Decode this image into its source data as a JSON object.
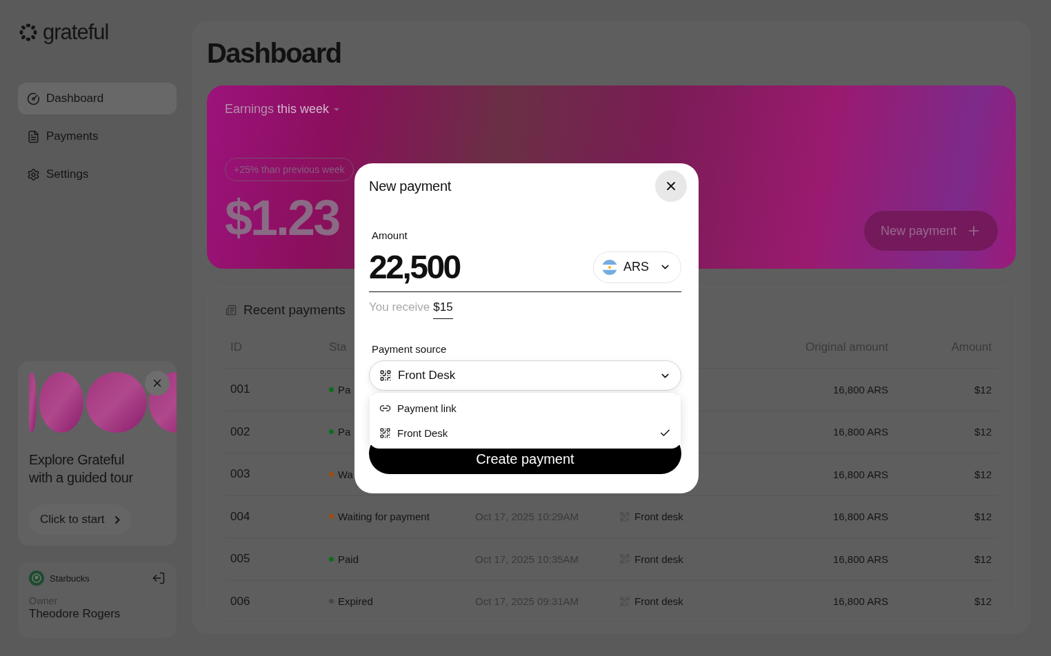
{
  "sidebar": {
    "logo": "grateful",
    "nav": [
      {
        "label": "Dashboard",
        "selected": true
      },
      {
        "label": "Payments",
        "selected": false
      },
      {
        "label": "Settings",
        "selected": false
      }
    ],
    "tour": {
      "title": "Explore Grateful with a guided tour",
      "button": "Click to start"
    },
    "account": {
      "business": "Starbucks",
      "role": "Owner",
      "name": "Theodore Rogers"
    }
  },
  "page": {
    "title": "Dashboard"
  },
  "earnings": {
    "period": "Earnings **this week**",
    "change": "+25% than previous week",
    "total": "$1.23",
    "button": "New payment"
  },
  "recent": {
    "title": "Recent payments",
    "columns": [
      "ID",
      "Sta",
      "Original amount",
      "Amount"
    ],
    "rows": [
      {
        "id": "001",
        "status": "Pa",
        "color": "#0e6e1f",
        "original": "16,800 ARS",
        "amount": "$12"
      },
      {
        "id": "002",
        "status": "Pa",
        "color": "#0e6e1f",
        "original": "16,800 ARS",
        "amount": "$12"
      },
      {
        "id": "003",
        "status": "Wa",
        "color": "#a04a12",
        "original": "16,800 ARS",
        "amount": "$12"
      },
      {
        "id": "004",
        "status": "Waiting for payment",
        "color": "#a04a12",
        "date": "Oct 17, 2025 10:29AM",
        "source": "Front desk",
        "original": "16,800 ARS",
        "amount": "$12"
      },
      {
        "id": "005",
        "status": "Paid",
        "color": "#0e6e1f",
        "date": "Oct 17, 2025 10:35AM",
        "source": "Front desk",
        "original": "16,800 ARS",
        "amount": "$12"
      },
      {
        "id": "006",
        "status": "Expired",
        "color": "#474747",
        "date": "Oct 17, 2025 09:31AM",
        "source": "Front desk",
        "original": "16,800 ARS",
        "amount": "$12"
      }
    ]
  },
  "modal": {
    "title": "New payment",
    "amount_label": "Amount",
    "amount": "22,500",
    "currency": "ARS",
    "receive_label": "You receive",
    "receive_value": "$15",
    "source_label": "Payment source",
    "source_value": "Front Desk",
    "expanded": true,
    "source_options": [
      {
        "label": "Payment link",
        "selected": false
      },
      {
        "label": "Front Desk",
        "selected": true
      }
    ],
    "submit": "Create payment"
  }
}
